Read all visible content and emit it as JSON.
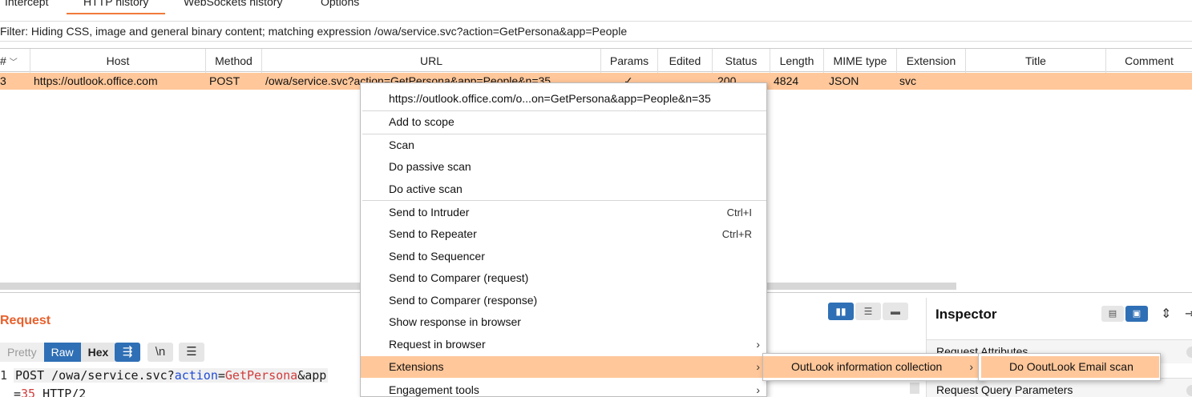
{
  "tabs": [
    {
      "label": "Intercept",
      "active": false
    },
    {
      "label": "HTTP history",
      "active": true
    },
    {
      "label": "WebSockets history",
      "active": false
    },
    {
      "label": "Options",
      "active": false
    }
  ],
  "filter": {
    "text": "Filter: Hiding CSS, image and general binary content;  matching expression /owa/service.svc?action=GetPersona&app=People"
  },
  "table": {
    "columns": [
      "# ",
      "Host",
      "Method",
      "URL",
      "Params",
      "Edited",
      "Status",
      "Length",
      "MIME type",
      "Extension",
      "Title",
      "Comment"
    ],
    "sort_icon": "chevron-down-icon",
    "rows": [
      {
        "num": "3",
        "host": "https://outlook.office.com",
        "method": "POST",
        "url": "/owa/service.svc?action=GetPersona&app=People&n=35",
        "params": "✓",
        "status": "200",
        "length": "4824",
        "mime": "JSON",
        "extension": "svc"
      }
    ]
  },
  "request_panel": {
    "title": "Request",
    "view_tabs": [
      "Pretty",
      "Raw",
      "Hex"
    ],
    "active_view": "Raw",
    "newline_label": "\\n",
    "line_number": "1",
    "code_line1_a": "POST /owa/service.svc?",
    "code_line1_b": "action",
    "code_line1_c": "=",
    "code_line1_d": "GetPersona",
    "code_line1_e": "&app",
    "code_line2_a": "=",
    "code_line2_b": "35",
    "code_line2_c": " HTTP/2"
  },
  "inspector": {
    "title": "Inspector",
    "rows": [
      "Request Attributes",
      "Request Query Parameters"
    ]
  },
  "context_menu": {
    "items": [
      {
        "label": "https://outlook.office.com/o...on=GetPersona&app=People&n=35"
      },
      {
        "label": "Add to scope"
      },
      {
        "label": "Scan"
      },
      {
        "label": "Do passive scan"
      },
      {
        "label": "Do active scan"
      },
      {
        "label": "Send to Intruder",
        "shortcut": "Ctrl+I"
      },
      {
        "label": "Send to Repeater",
        "shortcut": "Ctrl+R"
      },
      {
        "label": "Send to Sequencer"
      },
      {
        "label": "Send to Comparer (request)"
      },
      {
        "label": "Send to Comparer (response)"
      },
      {
        "label": "Show response in browser"
      },
      {
        "label": "Request in browser",
        "submenu": true
      },
      {
        "label": "Extensions",
        "submenu": true,
        "highlighted": true
      },
      {
        "label": "Engagement tools",
        "submenu": true
      }
    ]
  },
  "extensions_submenu": {
    "label": "OutLook information collection",
    "highlighted": true
  },
  "outlook_submenu": {
    "label": "Do OoutLook Email scan",
    "highlighted": true
  },
  "colors": {
    "accent": "#f07a3a",
    "highlight": "#ffc79a",
    "blue": "#2f6fb5"
  }
}
